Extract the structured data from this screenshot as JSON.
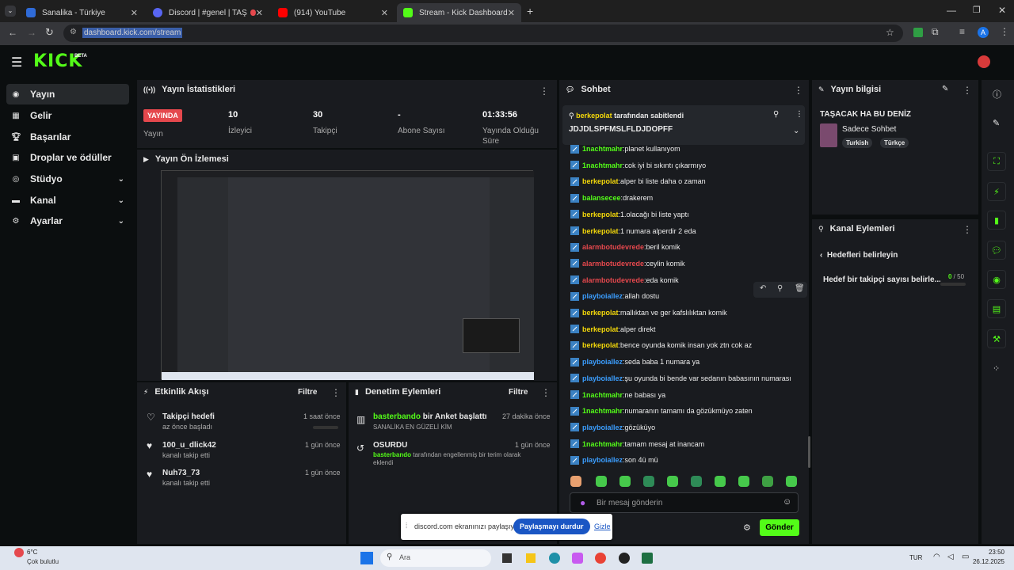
{
  "browser": {
    "tabs": [
      {
        "label": "Sanalika - Türkiye",
        "color": "#2f6bd8"
      },
      {
        "label": "Discord | #genel | TAŞACAK",
        "color": "#5865f2"
      },
      {
        "label": "(914) YouTube",
        "color": "#ff0000"
      },
      {
        "label": "Stream - Kick Dashboard",
        "color": "#53fc18"
      }
    ],
    "url": "dashboard.kick.com/stream",
    "profile": "A"
  },
  "header": {
    "logo": "KICK",
    "beta": "BETA"
  },
  "sidebar": {
    "items": [
      {
        "label": "Yayın"
      },
      {
        "label": "Gelir"
      },
      {
        "label": "Başarılar"
      },
      {
        "label": "Droplar ve ödüller"
      },
      {
        "label": "Stüdyo"
      },
      {
        "label": "Kanal"
      },
      {
        "label": "Ayarlar"
      }
    ]
  },
  "stats": {
    "title": "Yayın İstatistikleri",
    "live_badge": "YAYINDA",
    "live_label": "Yayın",
    "viewers": "10",
    "viewers_label": "İzleyici",
    "followers": "30",
    "followers_label": "Takipçi",
    "subs": "-",
    "subs_label": "Abone Sayısı",
    "uptime": "01:33:56",
    "uptime_label1": "Yayında Olduğu",
    "uptime_label2": "Süre"
  },
  "preview": {
    "title": "Yayın Ön İzlemesi"
  },
  "activity": {
    "title": "Etkinlik Akışı",
    "filter": "Filtre",
    "items": [
      {
        "title": "Takipçi hedefi",
        "sub": "az önce başladı",
        "time": "1 saat önce"
      },
      {
        "title": "100_u_dlick42",
        "sub": "kanalı takip etti",
        "time": "1 gün önce"
      },
      {
        "title": "Nuh73_73",
        "sub": "kanalı takip etti",
        "time": "1 gün önce"
      }
    ]
  },
  "moderation": {
    "title": "Denetim Eylemleri",
    "filter": "Filtre",
    "items": [
      {
        "user": "basterbando",
        "action": "bir Anket başlattı",
        "sub": "SANALİKA EN GÜZELİ KİM",
        "time": "27 dakika önce"
      },
      {
        "title": "OSURDU",
        "user": "basterbando",
        "action": "tarafından engellenmiş bir terim olarak",
        "action2": "eklendi",
        "time": "1 gün önce"
      }
    ]
  },
  "chat": {
    "title": "Sohbet",
    "pinned_by": "berkepolat",
    "pinned_suffix": "tarafından sabitlendi",
    "pinned_msg": "JDJDLSPFMSLFLDJDOPFF",
    "messages": [
      {
        "user": "1nachtmahr",
        "text": "planet kullanıyom",
        "color": "green"
      },
      {
        "user": "1nachtmahr",
        "text": "cok iyi bi sıkıntı çıkarmıyo",
        "color": "green"
      },
      {
        "user": "berkepolat",
        "text": "alper bi liste daha o zaman",
        "color": "yellow"
      },
      {
        "user": "balansecee",
        "text": "drakerem",
        "color": "green"
      },
      {
        "user": "berkepolat",
        "text": "1.olacağı bi liste yaptı",
        "color": "yellow"
      },
      {
        "user": "berkepolat",
        "text": "1 numara alperdir 2 eda",
        "color": "yellow"
      },
      {
        "user": "alarmbotudevrede",
        "text": "beril komik",
        "color": "red"
      },
      {
        "user": "alarmbotudevrede",
        "text": "ceylin komik",
        "color": "red"
      },
      {
        "user": "alarmbotudevrede",
        "text": "eda komik",
        "color": "red"
      },
      {
        "user": "playboiallez",
        "text": "allah dostu",
        "color": "blue"
      },
      {
        "user": "berkepolat",
        "text": "mallıktan ve ger kafslılıktan komik",
        "color": "yellow"
      },
      {
        "user": "berkepolat",
        "text": "alper direkt",
        "color": "yellow"
      },
      {
        "user": "berkepolat",
        "text": "bence oyunda komik insan yok ztn cok az",
        "color": "yellow"
      },
      {
        "user": "playboiallez",
        "text": "seda baba 1 numara ya",
        "color": "blue"
      },
      {
        "user": "playboiallez",
        "text": "şu oyunda bi bende var sedanın babasının numarası",
        "color": "blue"
      },
      {
        "user": "1nachtmahr",
        "text": "ne babası ya",
        "color": "green"
      },
      {
        "user": "1nachtmahr",
        "text": "numaranın tamamı da gözükmüyo zaten",
        "color": "green"
      },
      {
        "user": "playboiallez",
        "text": "gözüküyo",
        "color": "blue"
      },
      {
        "user": "1nachtmahr",
        "text": "tamam mesaj at inancam",
        "color": "green"
      },
      {
        "user": "playboiallez",
        "text": "son 4ü mü",
        "color": "blue"
      }
    ],
    "placeholder": "Bir mesaj gönderin",
    "send": "Gönder"
  },
  "streaminfo": {
    "title": "Yayın bilgisi",
    "stream_title": "TAŞACAK HA BU DENİZ",
    "category": "Sadece Sohbet",
    "tags": [
      "Turkish",
      "Türkçe"
    ]
  },
  "channel_actions": {
    "title": "Kanal Eylemleri",
    "back_label": "Hedefleri belirleyin",
    "goal_label": "Hedef bir takipçi sayısı belirle...",
    "goal_progress": "0 / 50"
  },
  "share": {
    "text": "discord.com ekranınızı paylaşıyor.",
    "stop": "Paylaşmayı durdur",
    "hide": "Gizle"
  },
  "taskbar": {
    "temp": "6°C",
    "weather": "Çok bulutlu",
    "search": "Ara",
    "lang": "TUR",
    "time": "23:50",
    "date": "26.12.2025"
  }
}
